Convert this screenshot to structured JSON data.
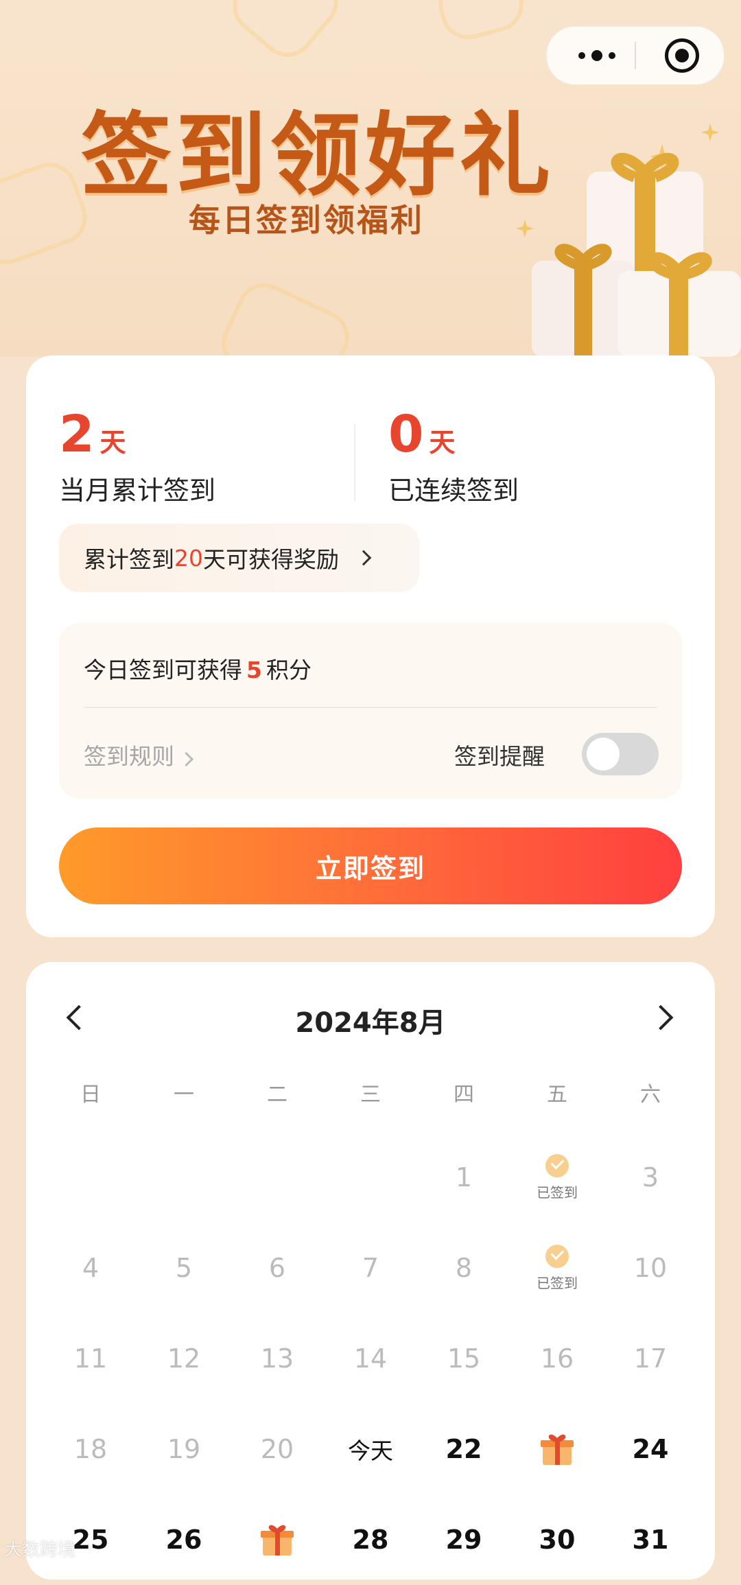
{
  "banner": {
    "title": "签到领好礼",
    "subtitle": "每日签到领福利"
  },
  "summary": {
    "monthly_count": "2",
    "monthly_unit": "天",
    "monthly_label": "当月累计签到",
    "streak_count": "0",
    "streak_unit": "天",
    "streak_label": "已连续签到",
    "reward_prefix": "累计签到",
    "reward_days": "20",
    "reward_suffix": "天可获得奖励"
  },
  "today_panel": {
    "prefix": "今日签到可获得",
    "points": "5",
    "suffix": "积分",
    "rules_label": "签到规则",
    "reminder_label": "签到提醒",
    "reminder_on": false
  },
  "signin_button": "立即签到",
  "calendar": {
    "month_label": "2024年8月",
    "weekdays": [
      "日",
      "一",
      "二",
      "三",
      "四",
      "五",
      "六"
    ],
    "signed_label": "已签到",
    "today_label": "今天",
    "leading_blanks": 4,
    "days": [
      {
        "d": "1",
        "state": "past"
      },
      {
        "d": "2",
        "state": "signed"
      },
      {
        "d": "3",
        "state": "past"
      },
      {
        "d": "4",
        "state": "past"
      },
      {
        "d": "5",
        "state": "past"
      },
      {
        "d": "6",
        "state": "past"
      },
      {
        "d": "7",
        "state": "past"
      },
      {
        "d": "8",
        "state": "past"
      },
      {
        "d": "9",
        "state": "signed"
      },
      {
        "d": "10",
        "state": "past"
      },
      {
        "d": "11",
        "state": "past"
      },
      {
        "d": "12",
        "state": "past"
      },
      {
        "d": "13",
        "state": "past"
      },
      {
        "d": "14",
        "state": "past"
      },
      {
        "d": "15",
        "state": "past"
      },
      {
        "d": "16",
        "state": "past"
      },
      {
        "d": "17",
        "state": "past"
      },
      {
        "d": "18",
        "state": "past"
      },
      {
        "d": "19",
        "state": "past"
      },
      {
        "d": "20",
        "state": "past"
      },
      {
        "d": "21",
        "state": "today"
      },
      {
        "d": "22",
        "state": "future"
      },
      {
        "d": "23",
        "state": "gift"
      },
      {
        "d": "24",
        "state": "future"
      },
      {
        "d": "25",
        "state": "future"
      },
      {
        "d": "26",
        "state": "future"
      },
      {
        "d": "27",
        "state": "gift"
      },
      {
        "d": "28",
        "state": "future"
      },
      {
        "d": "29",
        "state": "future"
      },
      {
        "d": "30",
        "state": "future"
      },
      {
        "d": "31",
        "state": "future"
      }
    ]
  },
  "watermark": "大数跨境",
  "colors": {
    "accent": "#e8452f",
    "button_start": "#ff9a2a",
    "button_end": "#ff3f3f",
    "background": "#f7e3cd"
  }
}
